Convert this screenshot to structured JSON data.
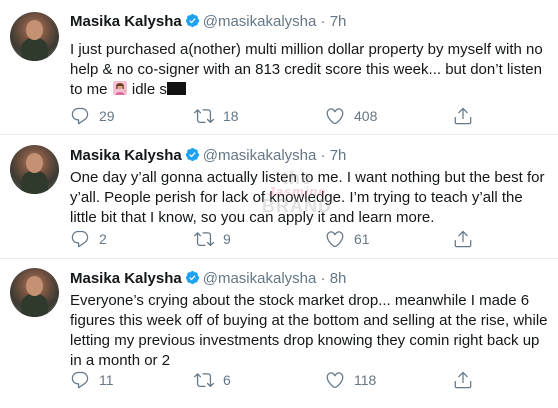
{
  "accent_color": "#1da1f2",
  "tweets": [
    {
      "name": "Masika Kalysha",
      "handle": "@masikakalysha",
      "dot": "·",
      "time": "7h",
      "text_main": "I just purchased a(nother) multi million dollar property by myself with no help & no co-signer with an 813 credit score this week... but don’t listen to me",
      "text_tail": "idle s",
      "emoji_icon": "woman-tipping-hand-emoji",
      "replies": "29",
      "retweets": "18",
      "likes": "408"
    },
    {
      "name": "Masika Kalysha",
      "handle": "@masikakalysha",
      "dot": "·",
      "time": "7h",
      "text_main": "One day y’all gonna actually listen to me. I want nothing but the best for y’all. People perish for lack of knowledge. I’m trying to teach y’all the little bit that I know, so you can apply it and learn more.",
      "replies": "2",
      "retweets": "9",
      "likes": "61"
    },
    {
      "name": "Masika Kalysha",
      "handle": "@masikakalysha",
      "dot": "·",
      "time": "8h",
      "text_main": "Everyone’s crying about the stock market drop... meanwhile I made 6 figures this week off of buying at the bottom and selling at the rise, while letting my previous investments drop knowing they comin right back up in a month or 2",
      "replies": "11",
      "retweets": "6",
      "likes": "118"
    }
  ],
  "watermark": {
    "line1": "the",
    "line2": "Jasmine",
    "line3": "BRAND"
  }
}
